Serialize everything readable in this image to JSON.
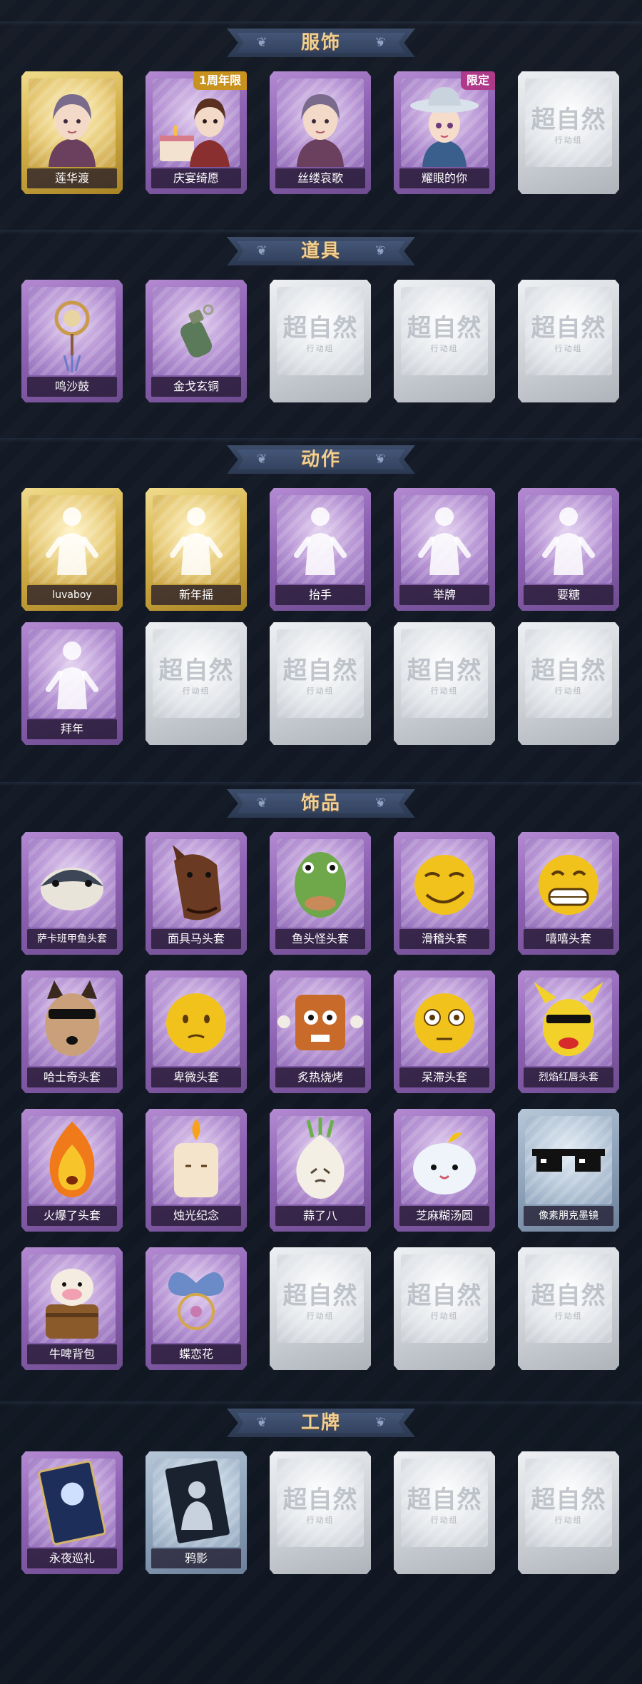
{
  "sections": [
    {
      "title": "服饰",
      "rows": [
        [
          {
            "label": "莲华渡",
            "style": "gold",
            "art": "costume",
            "tag": "",
            "tag_color": ""
          },
          {
            "label": "庆宴绮愿",
            "style": "purple",
            "art": "costume-cake",
            "tag": "1周年限",
            "tag_color": "gold-tag"
          },
          {
            "label": "丝缕哀歌",
            "style": "purple",
            "art": "costume",
            "tag": "",
            "tag_color": ""
          },
          {
            "label": "耀眼的你",
            "style": "purple",
            "art": "costume-hat",
            "tag": "限定",
            "tag_color": "purple-tag"
          },
          {
            "label": "",
            "style": "gray",
            "art": "placeholder",
            "tag": "",
            "tag_color": ""
          }
        ]
      ]
    },
    {
      "title": "道具",
      "rows": [
        [
          {
            "label": "鸣沙鼓",
            "style": "purple",
            "art": "prop-drum",
            "tag": "",
            "tag_color": ""
          },
          {
            "label": "金戈玄铜",
            "style": "purple",
            "art": "prop-grenade",
            "tag": "",
            "tag_color": ""
          },
          {
            "label": "",
            "style": "gray",
            "art": "placeholder",
            "tag": "",
            "tag_color": ""
          },
          {
            "label": "",
            "style": "gray",
            "art": "placeholder",
            "tag": "",
            "tag_color": ""
          },
          {
            "label": "",
            "style": "gray",
            "art": "placeholder",
            "tag": "",
            "tag_color": ""
          }
        ]
      ]
    },
    {
      "title": "动作",
      "rows": [
        [
          {
            "label": "luvaboy",
            "style": "gold",
            "art": "pose",
            "tag": "",
            "tag_color": ""
          },
          {
            "label": "新年摇",
            "style": "gold",
            "art": "pose",
            "tag": "",
            "tag_color": ""
          },
          {
            "label": "抬手",
            "style": "purple",
            "art": "pose",
            "tag": "",
            "tag_color": ""
          },
          {
            "label": "举牌",
            "style": "purple",
            "art": "pose",
            "tag": "",
            "tag_color": ""
          },
          {
            "label": "要糖",
            "style": "purple",
            "art": "pose",
            "tag": "",
            "tag_color": ""
          }
        ],
        [
          {
            "label": "拜年",
            "style": "purple",
            "art": "pose",
            "tag": "",
            "tag_color": ""
          },
          {
            "label": "",
            "style": "gray",
            "art": "placeholder",
            "tag": "",
            "tag_color": ""
          },
          {
            "label": "",
            "style": "gray",
            "art": "placeholder",
            "tag": "",
            "tag_color": ""
          },
          {
            "label": "",
            "style": "gray",
            "art": "placeholder",
            "tag": "",
            "tag_color": ""
          },
          {
            "label": "",
            "style": "gray",
            "art": "placeholder",
            "tag": "",
            "tag_color": ""
          }
        ]
      ]
    },
    {
      "title": "饰品",
      "rows": [
        [
          {
            "label": "萨卡班甲鱼头套",
            "style": "purple",
            "art": "head-fish",
            "tag": "",
            "tag_color": ""
          },
          {
            "label": "面具马头套",
            "style": "purple",
            "art": "head-horse",
            "tag": "",
            "tag_color": ""
          },
          {
            "label": "鱼头怪头套",
            "style": "purple",
            "art": "head-green",
            "tag": "",
            "tag_color": ""
          },
          {
            "label": "滑稽头套",
            "style": "purple",
            "art": "emoji-smirk",
            "tag": "",
            "tag_color": ""
          },
          {
            "label": "嘻嘻头套",
            "style": "purple",
            "art": "emoji-grin",
            "tag": "",
            "tag_color": ""
          }
        ],
        [
          {
            "label": "哈士奇头套",
            "style": "purple",
            "art": "head-dog",
            "tag": "",
            "tag_color": ""
          },
          {
            "label": "卑微头套",
            "style": "purple",
            "art": "emoji-shy",
            "tag": "",
            "tag_color": ""
          },
          {
            "label": "炙热烧烤",
            "style": "purple",
            "art": "head-bbq",
            "tag": "",
            "tag_color": ""
          },
          {
            "label": "呆滞头套",
            "style": "purple",
            "art": "emoji-stare",
            "tag": "",
            "tag_color": ""
          },
          {
            "label": "烈焰红唇头套",
            "style": "purple",
            "art": "head-pika",
            "tag": "",
            "tag_color": ""
          }
        ],
        [
          {
            "label": "火爆了头套",
            "style": "purple",
            "art": "head-fire",
            "tag": "",
            "tag_color": ""
          },
          {
            "label": "烛光纪念",
            "style": "purple",
            "art": "head-candle",
            "tag": "",
            "tag_color": ""
          },
          {
            "label": "蒜了八",
            "style": "purple",
            "art": "head-garlic",
            "tag": "",
            "tag_color": ""
          },
          {
            "label": "芝麻糊汤圆",
            "style": "purple",
            "art": "head-dumpling",
            "tag": "",
            "tag_color": ""
          },
          {
            "label": "像素朋克墨镜",
            "style": "blue",
            "art": "glasses",
            "tag": "",
            "tag_color": ""
          }
        ],
        [
          {
            "label": "牛啤背包",
            "style": "purple",
            "art": "backpack",
            "tag": "",
            "tag_color": ""
          },
          {
            "label": "蝶恋花",
            "style": "purple",
            "art": "ornament",
            "tag": "",
            "tag_color": ""
          },
          {
            "label": "",
            "style": "gray",
            "art": "placeholder",
            "tag": "",
            "tag_color": ""
          },
          {
            "label": "",
            "style": "gray",
            "art": "placeholder",
            "tag": "",
            "tag_color": ""
          },
          {
            "label": "",
            "style": "gray",
            "art": "placeholder",
            "tag": "",
            "tag_color": ""
          }
        ]
      ]
    },
    {
      "title": "工牌",
      "rows": [
        [
          {
            "label": "永夜巡礼",
            "style": "purple",
            "art": "badge-night",
            "tag": "",
            "tag_color": ""
          },
          {
            "label": "鸦影",
            "style": "blue",
            "art": "badge-shadow",
            "tag": "",
            "tag_color": ""
          },
          {
            "label": "",
            "style": "gray",
            "art": "placeholder",
            "tag": "",
            "tag_color": ""
          },
          {
            "label": "",
            "style": "gray",
            "art": "placeholder",
            "tag": "",
            "tag_color": ""
          },
          {
            "label": "",
            "style": "gray",
            "art": "placeholder",
            "tag": "",
            "tag_color": ""
          }
        ]
      ]
    }
  ],
  "placeholder_watermark": "超自然",
  "placeholder_subtitle": "行动组",
  "colors": {
    "header_text": "#f1cf93",
    "header_plate": "#3c4c69",
    "background": "#131a24",
    "rarity_purple": "#8d62b3",
    "rarity_gold": "#d4b149",
    "rarity_gray": "#cfd3d8",
    "rarity_blue": "#8ea3ba"
  }
}
